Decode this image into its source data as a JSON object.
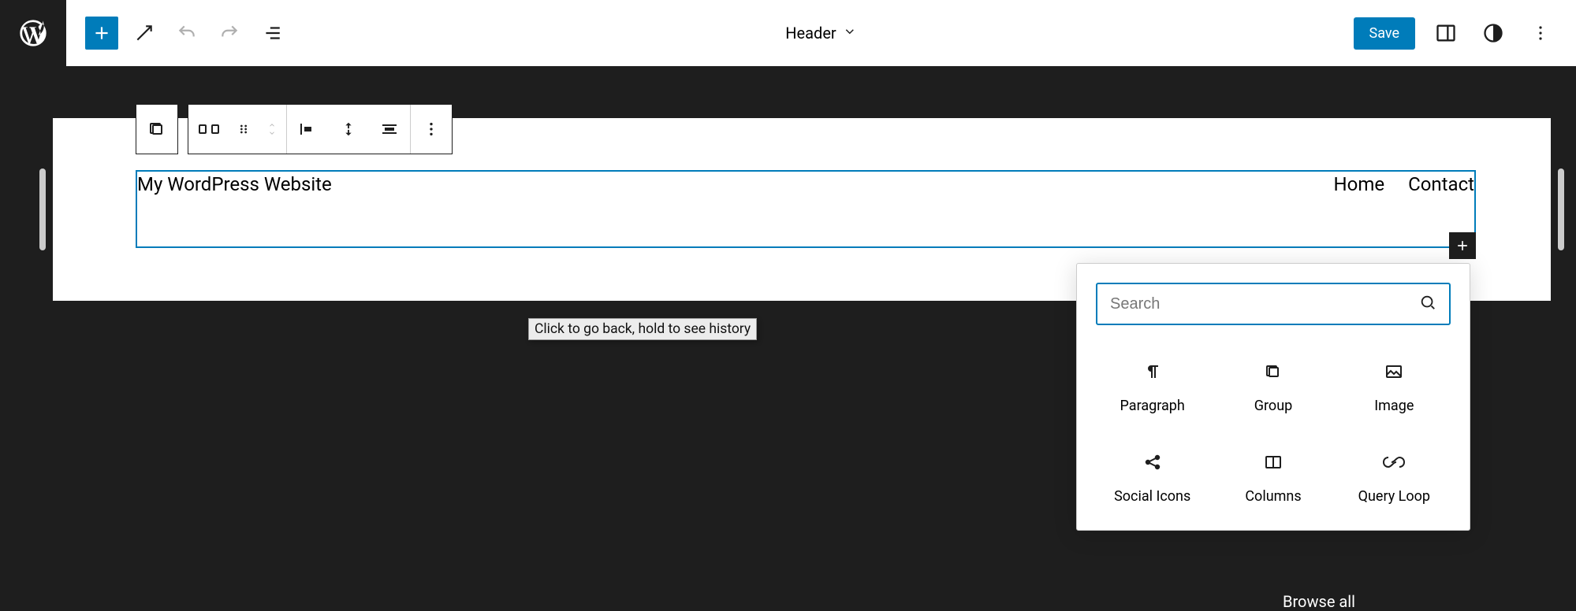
{
  "topbar": {
    "template_label": "Header",
    "save_label": "Save"
  },
  "header_block": {
    "site_title": "My WordPress Website",
    "nav": [
      "Home",
      "Contact"
    ]
  },
  "tooltip": "Click to go back, hold to see history",
  "inserter": {
    "search_placeholder": "Search",
    "blocks": [
      {
        "name": "Paragraph",
        "icon": "paragraph-icon"
      },
      {
        "name": "Group",
        "icon": "group-icon"
      },
      {
        "name": "Image",
        "icon": "image-icon"
      },
      {
        "name": "Social Icons",
        "icon": "share-icon"
      },
      {
        "name": "Columns",
        "icon": "columns-icon"
      },
      {
        "name": "Query Loop",
        "icon": "loop-icon"
      }
    ],
    "browse_all_label": "Browse all"
  }
}
